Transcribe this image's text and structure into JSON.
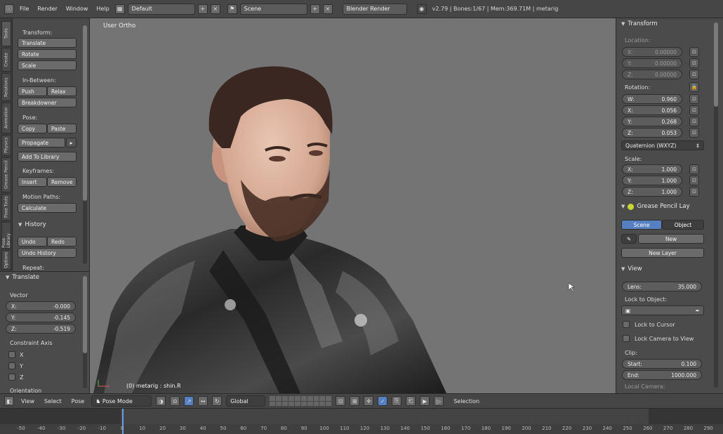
{
  "topbar": {
    "menus": [
      "File",
      "Render",
      "Window",
      "Help"
    ],
    "layout": "Default",
    "scene": "Scene",
    "engine": "Blender Render",
    "stats": "v2.79 | Bones:1/67 | Mem:369.71M | metarig"
  },
  "left_tabs": [
    "Tools",
    "Create",
    "Relations",
    "Animation",
    "Physics",
    "Grease Pencil",
    "Pose Tools",
    "Pose Library",
    "Options"
  ],
  "tools": {
    "transform_label": "Transform:",
    "translate": "Translate",
    "rotate": "Rotate",
    "scale": "Scale",
    "inbetween_label": "In-Between:",
    "push": "Push",
    "relax": "Relax",
    "breakdowner": "Breakdowner",
    "pose_label": "Pose:",
    "copy": "Copy",
    "paste": "Paste",
    "propagate": "Propagate",
    "add_to_library": "Add To Library",
    "keyframes_label": "Keyframes:",
    "insert": "Insert",
    "remove": "Remove",
    "motion_paths_label": "Motion Paths:",
    "calculate": "Calculate",
    "history_header": "History",
    "undo": "Undo",
    "redo": "Redo",
    "undo_history": "Undo History",
    "repeat_label": "Repeat:"
  },
  "operator": {
    "header": "Translate",
    "vector_label": "Vector",
    "x_label": "X:",
    "x": "-0.000",
    "y_label": "Y:",
    "y": "-0.145",
    "z_label": "Z:",
    "z": "-0.519",
    "constraint_label": "Constraint Axis",
    "axes": [
      "X",
      "Y",
      "Z"
    ],
    "orientation_label": "Orientation"
  },
  "viewport": {
    "view_label": "User Ortho",
    "object_label": "(0) metarig : shin.R"
  },
  "right": {
    "transform_header": "Transform",
    "location_label": "Location:",
    "loc": [
      {
        "axis": "X:",
        "value": "0.00000"
      },
      {
        "axis": "Y:",
        "value": "0.00000"
      },
      {
        "axis": "Z:",
        "value": "0.00000"
      }
    ],
    "rotation_label": "Rotation:",
    "rot": [
      {
        "axis": "W:",
        "value": "0.960"
      },
      {
        "axis": "X:",
        "value": "0.056"
      },
      {
        "axis": "Y:",
        "value": "0.268"
      },
      {
        "axis": "Z:",
        "value": "0.053"
      }
    ],
    "rotation_mode": "Quaternion (WXYZ)",
    "scale_label": "Scale:",
    "scale": [
      {
        "axis": "X:",
        "value": "1.000"
      },
      {
        "axis": "Y:",
        "value": "1.000"
      },
      {
        "axis": "Z:",
        "value": "1.000"
      }
    ],
    "gp_header": "Grease Pencil Lay",
    "gp_scene": "Scene",
    "gp_object": "Object",
    "gp_new": "New",
    "gp_new_layer": "New Layer",
    "view_header": "View",
    "lens_label": "Lens:",
    "lens_value": "35.000",
    "lock_object_label": "Lock to Object:",
    "lock_cursor": "Lock to Cursor",
    "lock_camera": "Lock Camera to View",
    "clip_label": "Clip:",
    "start_label": "Start:",
    "start_value": "0.100",
    "end_label": "End:",
    "end_value": "1000.000",
    "local_camera": "Local Camera:"
  },
  "view_header": {
    "view": "View",
    "select": "Select",
    "pose": "Pose",
    "mode": "Pose Mode",
    "orientation": "Global",
    "selection": "Selection"
  },
  "timeline": {
    "ticks": [
      "-50",
      "-40",
      "-30",
      "-20",
      "-10",
      "0",
      "10",
      "20",
      "30",
      "40",
      "50",
      "60",
      "70",
      "80",
      "90",
      "100",
      "110",
      "120",
      "130",
      "140",
      "150",
      "160",
      "170",
      "180",
      "190",
      "200",
      "210",
      "220",
      "230",
      "240",
      "250",
      "260",
      "270",
      "280",
      "290"
    ],
    "current_frame": 0
  },
  "colors": {
    "panel": "#4b4b4b",
    "viewport": "#747474",
    "active_tab": "#5680c2",
    "button": "#6b6b6b",
    "header": "#464646"
  }
}
